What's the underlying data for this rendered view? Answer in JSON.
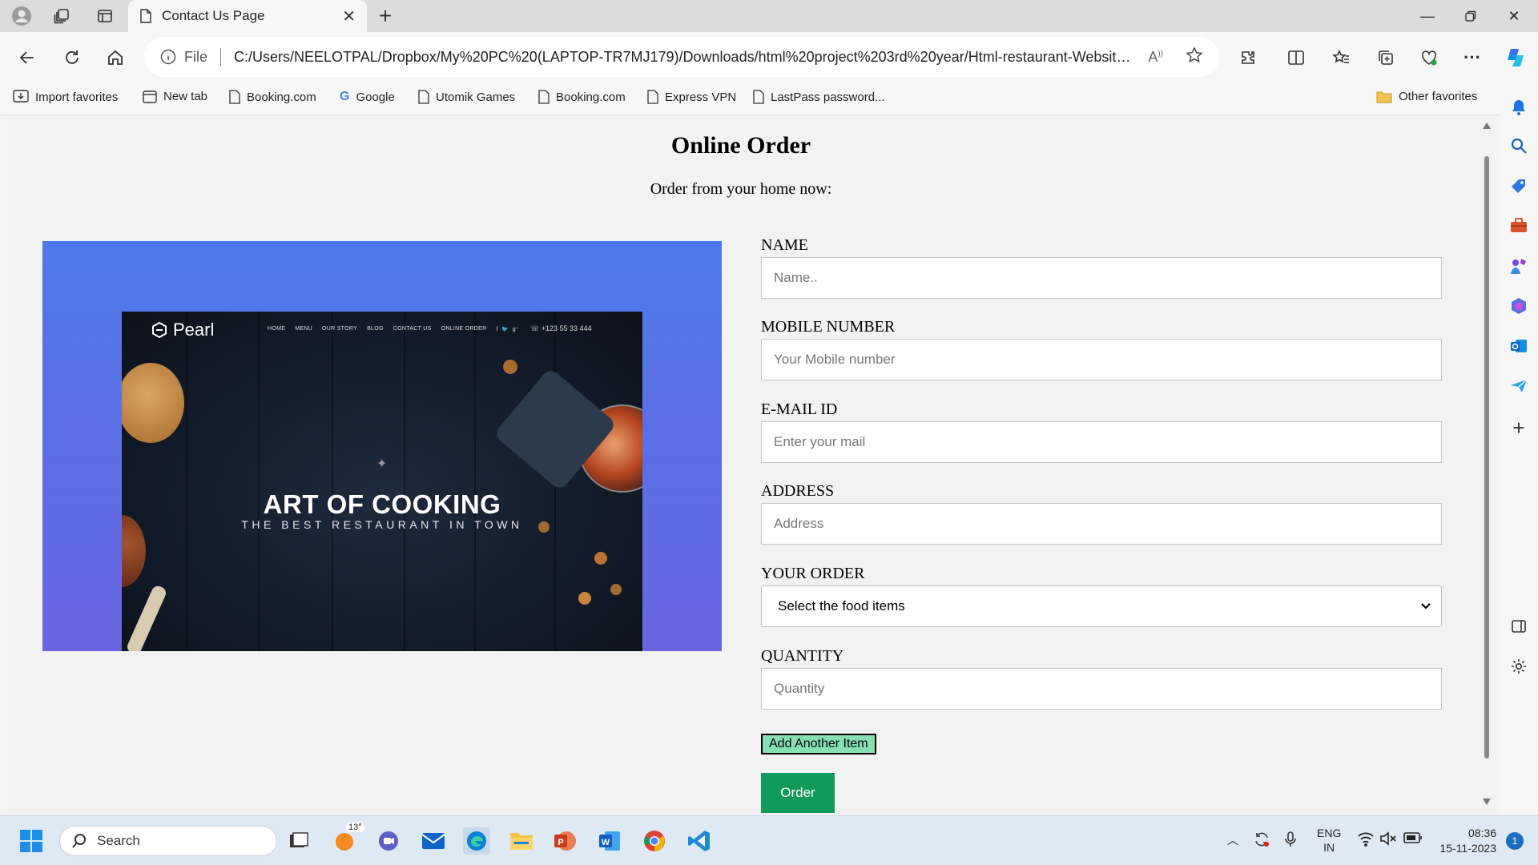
{
  "browser": {
    "tab_title": "Contact Us Page",
    "address_prefix": "File",
    "url": "C:/Users/NEELOTPAL/Dropbox/My%20PC%20(LAPTOP-TR7MJ179)/Downloads/html%20project%203rd%20year/Html-restaurant-Website-Creati...",
    "bookmarks": [
      "Import favorites",
      "New tab",
      "Booking.com",
      "Google",
      "Utomik Games",
      "Booking.com",
      "Express VPN",
      "LastPass password..."
    ],
    "other_favorites": "Other favorites"
  },
  "page": {
    "title": "Online Order",
    "subtitle": "Order from your home now:",
    "hero": {
      "brand": "Pearl",
      "nav": [
        "HOME",
        "MENU",
        "OUR STORY",
        "BLOG",
        "CONTACT US",
        "ONLINE ORDER"
      ],
      "phone": "+123 55 33 444",
      "headline": "ART OF COOKING",
      "tagline": "THE BEST RESTAURANT IN TOWN"
    },
    "form": {
      "name_label": "NAME",
      "name_placeholder": "Name..",
      "mobile_label": "MOBILE NUMBER",
      "mobile_placeholder": "Your Mobile number",
      "email_label": "E-MAIL ID",
      "email_placeholder": "Enter your mail",
      "address_label": "ADDRESS",
      "address_placeholder": "Address",
      "order_label": "YOUR ORDER",
      "order_selected": "Select the food items",
      "quantity_label": "QUANTITY",
      "quantity_placeholder": "Quantity",
      "add_button": "Add Another Item",
      "order_button": "Order"
    }
  },
  "taskbar": {
    "search_label": "Search",
    "weather_temp": "13°",
    "lang_top": "ENG",
    "lang_bottom": "IN",
    "time": "08:36",
    "date": "15-11-2023",
    "notification_count": "1"
  },
  "colors": {
    "hero_top": "#4e78e8",
    "hero_bottom": "#6a66e0",
    "order_button": "#0f9a5a",
    "add_button": "#86e0b4"
  }
}
